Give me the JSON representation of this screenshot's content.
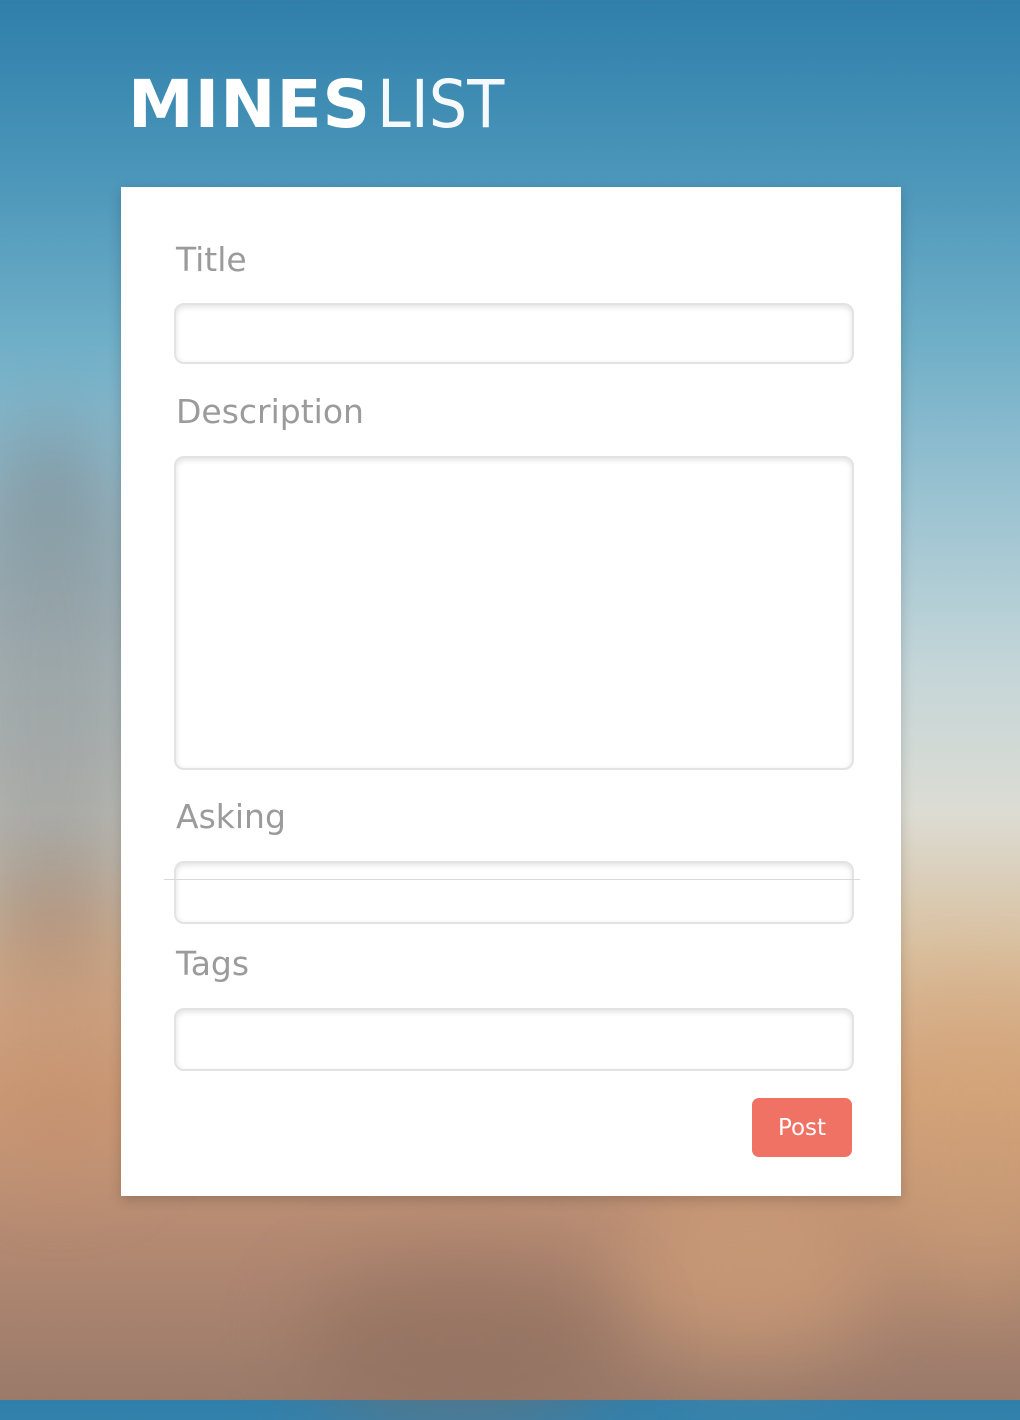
{
  "brand": {
    "name_bold": "MINES",
    "name_light": "LIST"
  },
  "form": {
    "fields": [
      {
        "label": "Title",
        "value": "",
        "type": "text"
      },
      {
        "label": "Description",
        "value": "",
        "type": "textarea"
      },
      {
        "label": "Asking",
        "value": "",
        "type": "text"
      },
      {
        "label": "Tags",
        "value": "",
        "type": "text"
      }
    ],
    "submit_label": "Post"
  },
  "colors": {
    "accent": "#ef7265",
    "label_text": "#9b9b9b",
    "card_background": "#ffffff",
    "brand_text": "#ffffff"
  }
}
